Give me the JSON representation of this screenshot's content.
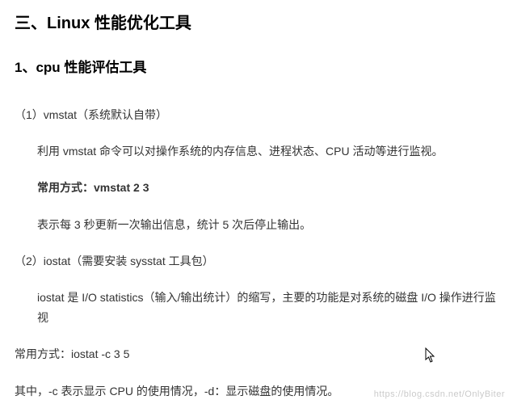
{
  "heading_main": "三、Linux 性能优化工具",
  "heading_sub": "1、cpu 性能评估工具",
  "sec1": {
    "title": "（1）vmstat（系统默认自带）",
    "p1": "利用 vmstat 命令可以对操作系统的内存信息、进程状态、CPU 活动等进行监视。",
    "usage": "常用方式：vmstat 2 3",
    "p2": "表示每 3 秒更新一次输出信息，统计 5 次后停止输出。"
  },
  "sec2": {
    "title": "（2）iostat（需要安装 sysstat 工具包）",
    "p1": "iostat 是 I/O statistics（输入/输出统计）的缩写，主要的功能是对系统的磁盘 I/O 操作进行监视",
    "usage": "常用方式：iostat  -c 3 5",
    "p2": "其中，-c 表示显示 CPU 的使用情况，-d：显示磁盘的使用情况。"
  },
  "watermark": "https://blog.csdn.net/OnlyBiter"
}
